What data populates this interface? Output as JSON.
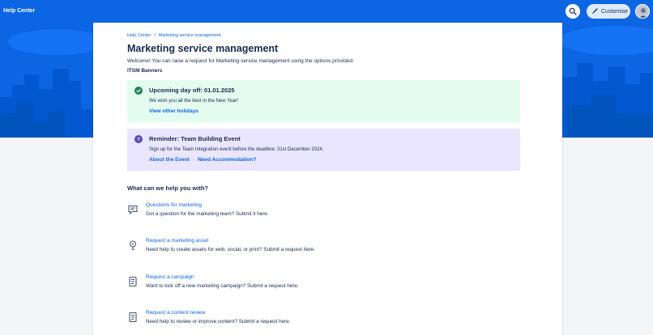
{
  "header": {
    "brand": "Help Center",
    "customise_label": "Customise"
  },
  "breadcrumb": {
    "items": [
      "Help Center",
      "Marketing service management"
    ],
    "separator": "/"
  },
  "page": {
    "title": "Marketing service management",
    "welcome": "Welcome! You can raise a request for Marketing service management using the options provided.",
    "banners_label": "ITSM Banners"
  },
  "banners": [
    {
      "heading": "Upcoming day off: 01.01.2025",
      "text": "We wish you all the best in the New Year!",
      "links": [
        "View other holidays"
      ],
      "icon": "check-circle-icon",
      "color": "#e3fcef"
    },
    {
      "heading": "Reminder: Team Building Event",
      "text": "Sign up for the Team Integration event before the deadline: 31st December 2024.",
      "links": [
        "About the Event",
        "Need Accommodation?"
      ],
      "link_separator": "·",
      "icon": "question-circle-icon",
      "color": "#eae6ff"
    }
  ],
  "help": {
    "heading": "What can we help you with?",
    "request_types": [
      {
        "name": "Questions for marketing",
        "description": "Got a question for the marketing team? Submit it here.",
        "icon": "chat-icon"
      },
      {
        "name": "Request a marketing asset",
        "description": "Need help to create assets for web, social, or print? Submit a request here.",
        "icon": "lightbulb-icon"
      },
      {
        "name": "Request a campaign",
        "description": "Want to kick off a new marketing campaign? Submit a request here.",
        "icon": "document-icon"
      },
      {
        "name": "Request a content review",
        "description": "Need help to review or improve content? Submit a request here.",
        "icon": "document-icon"
      }
    ]
  },
  "colors": {
    "brand_blue": "#0c66e4",
    "text": "#172b4d",
    "success": "#1f845a",
    "discovery": "#5e4db2"
  }
}
